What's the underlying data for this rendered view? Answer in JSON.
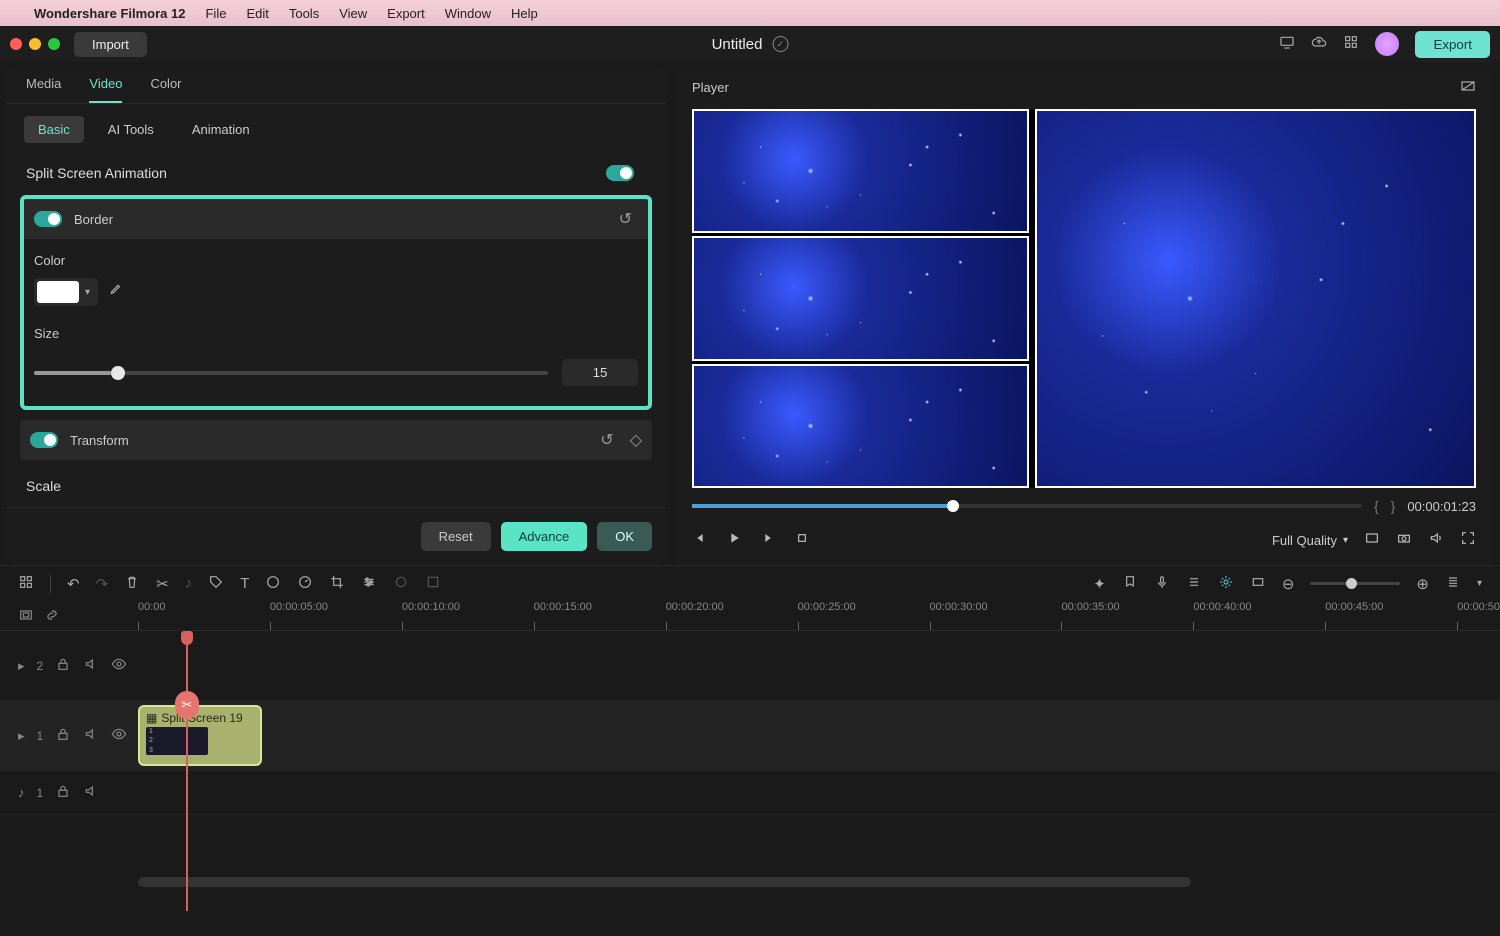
{
  "mac_menu": {
    "app": "Wondershare Filmora 12",
    "items": [
      "File",
      "Edit",
      "Tools",
      "View",
      "Export",
      "Window",
      "Help"
    ]
  },
  "titlebar": {
    "import": "Import",
    "project": "Untitled",
    "export": "Export"
  },
  "tabs": {
    "media": "Media",
    "video": "Video",
    "color": "Color"
  },
  "subtabs": {
    "basic": "Basic",
    "ai": "AI Tools",
    "anim": "Animation"
  },
  "panel": {
    "split_screen": "Split Screen Animation",
    "border": "Border",
    "color_label": "Color",
    "size_label": "Size",
    "size_value": "15",
    "transform": "Transform",
    "scale": "Scale",
    "reset": "Reset",
    "advance": "Advance",
    "ok": "OK",
    "border_color": "#ffffff"
  },
  "player": {
    "title": "Player",
    "timecode": "00:00:01:23",
    "quality": "Full Quality"
  },
  "timeline": {
    "ticks": [
      "00:00",
      "00:00:05:00",
      "00:00:10:00",
      "00:00:15:00",
      "00:00:20:00",
      "00:00:25:00",
      "00:00:30:00",
      "00:00:35:00",
      "00:00:40:00",
      "00:00:45:00",
      "00:00:50"
    ],
    "clip_title": "Split Screen 19",
    "clip_nums": [
      "1",
      "2",
      "3"
    ],
    "tracks": {
      "v2": "2",
      "v1": "1",
      "a1": "1"
    }
  }
}
